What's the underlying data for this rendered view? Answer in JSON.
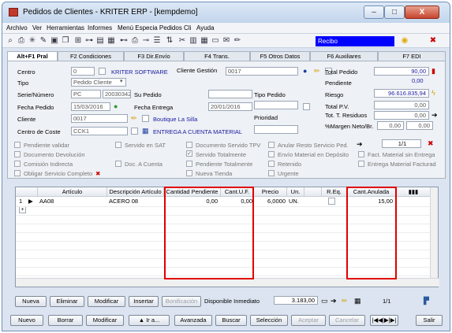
{
  "window": {
    "title": "Pedidos de Clientes - KRITER ERP - [kempdemo]",
    "controls": {
      "min": "–",
      "max": "□",
      "close": "X"
    }
  },
  "menu": [
    "Archivo",
    "Ver",
    "Herramientas",
    "Informes",
    "Menú Especia Pedidos Cli",
    "Ayuda"
  ],
  "toolbar": {
    "recibo": "Recibo"
  },
  "tabs": [
    "Alt+F1 Pral",
    "F2 Condiciones",
    "F3 Dir.Envío",
    "F4 Trans.",
    "F5 Otros Datos",
    "F6 Auxiliares",
    "F7 EDI"
  ],
  "header": {
    "centro_label": "Centro",
    "centro_value": "0",
    "centro_name": "KRITER SOFTWARE",
    "cliente_gestion_label": "Cliente Gestión",
    "cliente_gestion_value": "0017",
    "tipo_label": "Tipo",
    "tipo_value": "Pedido Cliente",
    "serie_label": "Serie/Número",
    "serie_value": "PC",
    "numero_value": "20030342",
    "su_pedido_label": "Su Pedido",
    "tipo_pedido_label": "Tipo Pedido",
    "fecha_pedido_label": "Fecha Pedido",
    "fecha_pedido_value": "15/03/2016",
    "fecha_entrega_label": "Fecha Entrega",
    "fecha_entrega_value": "20/01/2016",
    "cliente_label": "Cliente",
    "cliente_value": "0017",
    "cliente_name": "Boutique La Silla",
    "prioridad_label": "Prioridad",
    "centro_coste_label": "Centro de Coste",
    "centro_coste_value": "CCK1",
    "entrega_text": "ENTREGA A CUENTA MATERIAL"
  },
  "totals": {
    "total_pedido_label": "Total Pedido",
    "total_pedido_value": "90,00",
    "pendiente_label": "Pendiente",
    "pendiente_value": "0,00",
    "riesgo_label": "Riesgo",
    "riesgo_value": "96.616.835,94",
    "total_pv_label": "Total P.V.",
    "total_pv_value": "0,00",
    "residuos_label": "Tot. T. Residuos",
    "residuos_value": "0,00",
    "margen_label": "%Margen Neto/Br.",
    "margen_value1": "0,00",
    "margen_value2": "0,00",
    "page_value": "1/1"
  },
  "flags": {
    "col1": [
      "Pendiente validar",
      "Documento Devolución",
      "Comisión Indirecta",
      "Obligar Servicio Completo"
    ],
    "col2": [
      "Servido en SAT",
      "",
      "Doc. A Cuenta",
      ""
    ],
    "col3": [
      "Documento Servido TPV",
      "Servido Totalmente",
      "Pendiente Totalmente",
      "Nueva Tienda"
    ],
    "col4": [
      "Anular Resto Servicio Ped.",
      "Envío Material en Depósito",
      "Retenido",
      "Urgente"
    ],
    "col5": [
      "Fact. Material sin Entrega",
      "Entrega Material Facturad"
    ]
  },
  "grid": {
    "columns": [
      "Artículo",
      "Descripción Artículo",
      "Cantidad Pendiente",
      "Cant.U.F.",
      "Precio",
      "Un.",
      "R.Eq.",
      "Cant.Anulada"
    ],
    "rows": [
      {
        "num": "1",
        "articulo": "AA08",
        "descripcion": "ACERO 08",
        "cant_pendiente": "0,00",
        "cant_uf": "0,00",
        "precio": "6,0000",
        "un": "UN.",
        "cant_anulada": "15,00"
      }
    ]
  },
  "bottom": {
    "nueva": "Nueva",
    "eliminar": "Eliminar",
    "modificar": "Modificar",
    "insertar": "Insertar",
    "bonificacion": "Bonificación",
    "disponible_label": "Disponible Inmediato",
    "disponible_value": "3.183,00",
    "page": "1/1"
  },
  "actions": {
    "nuevo": "Nuevo",
    "borrar": "Borrar",
    "modificar": "Modificar",
    "ir_a": "Ir a...",
    "avanzada": "Avanzada",
    "buscar": "Buscar",
    "seleccion": "Selección",
    "aceptar": "Aceptar",
    "cancelar": "Cancelar",
    "salir": "Salir"
  }
}
